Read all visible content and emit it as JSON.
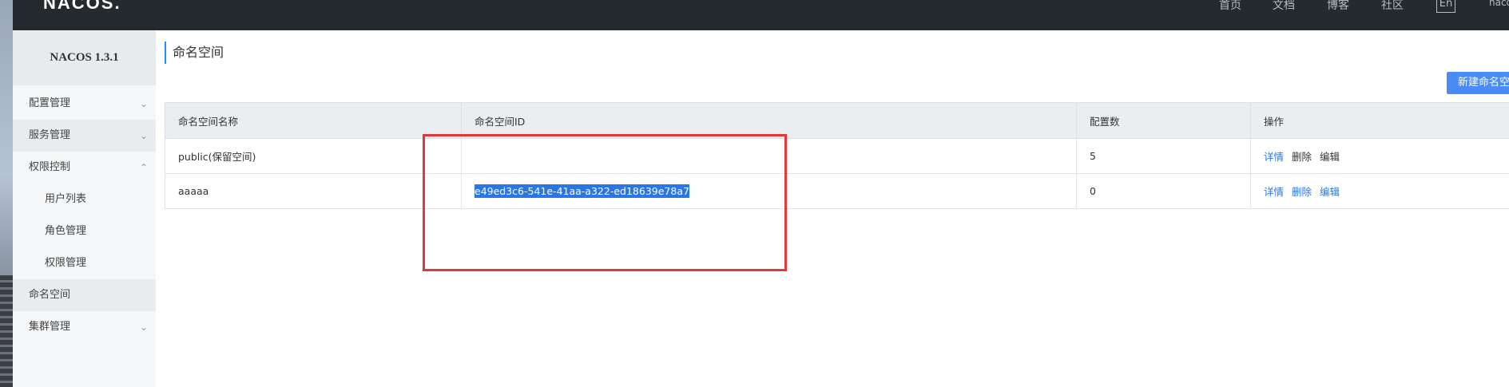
{
  "header": {
    "logo": "NACOS.",
    "nav": [
      "首页",
      "文档",
      "博客",
      "社区"
    ],
    "lang": "En",
    "user": "nacos"
  },
  "sidebar": {
    "version": "NACOS 1.3.1",
    "items": [
      {
        "label": "配置管理",
        "chevron": "down"
      },
      {
        "label": "服务管理",
        "chevron": "down"
      },
      {
        "label": "权限控制",
        "chevron": "up"
      },
      {
        "label": "用户列表"
      },
      {
        "label": "角色管理"
      },
      {
        "label": "权限管理"
      },
      {
        "label": "命名空间"
      },
      {
        "label": "集群管理",
        "chevron": "down"
      }
    ]
  },
  "main": {
    "title": "命名空间",
    "create_button": "新建命名空间",
    "table": {
      "headers": [
        "命名空间名称",
        "命名空间ID",
        "配置数",
        "操作"
      ],
      "rows": [
        {
          "name": "public(保留空间)",
          "id": "",
          "count": "5",
          "actions": [
            "详情",
            "删除",
            "编辑"
          ]
        },
        {
          "name": "aaaaa",
          "id": "e49ed3c6-541e-41aa-a322-ed18639e78a7",
          "count": "0",
          "actions": [
            "详情",
            "删除",
            "编辑"
          ]
        }
      ]
    }
  },
  "colors": {
    "topbar": "#252a2f",
    "accent": "#2b76e5",
    "highlight": "#e5363a"
  }
}
